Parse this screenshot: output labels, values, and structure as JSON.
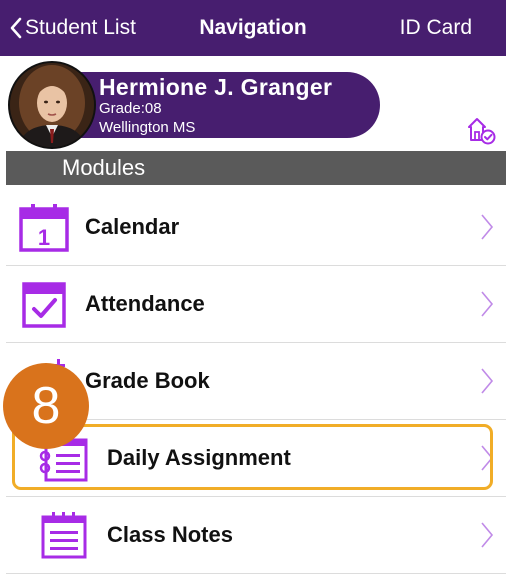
{
  "header": {
    "back_label": "Student List",
    "title": "Navigation",
    "id_card_label": "ID Card"
  },
  "student": {
    "name": "Hermione J. Granger",
    "grade": "Grade:08",
    "school": "Wellington MS"
  },
  "section": {
    "title": "Modules"
  },
  "modules": [
    {
      "label": "Calendar",
      "icon": "calendar-icon"
    },
    {
      "label": "Attendance",
      "icon": "attendance-icon"
    },
    {
      "label": "Grade Book",
      "icon": "grade-book-icon"
    },
    {
      "label": "Daily Assignment",
      "icon": "daily-assignment-icon"
    },
    {
      "label": "Class Notes",
      "icon": "class-notes-icon"
    }
  ],
  "annotation": {
    "step_number": "8"
  },
  "colors": {
    "brand_purple": "#471e6f",
    "icon_purple": "#a72be6",
    "section_gray": "#5a5a5a",
    "highlight": "#f1ad27",
    "badge": "#d9731c"
  }
}
